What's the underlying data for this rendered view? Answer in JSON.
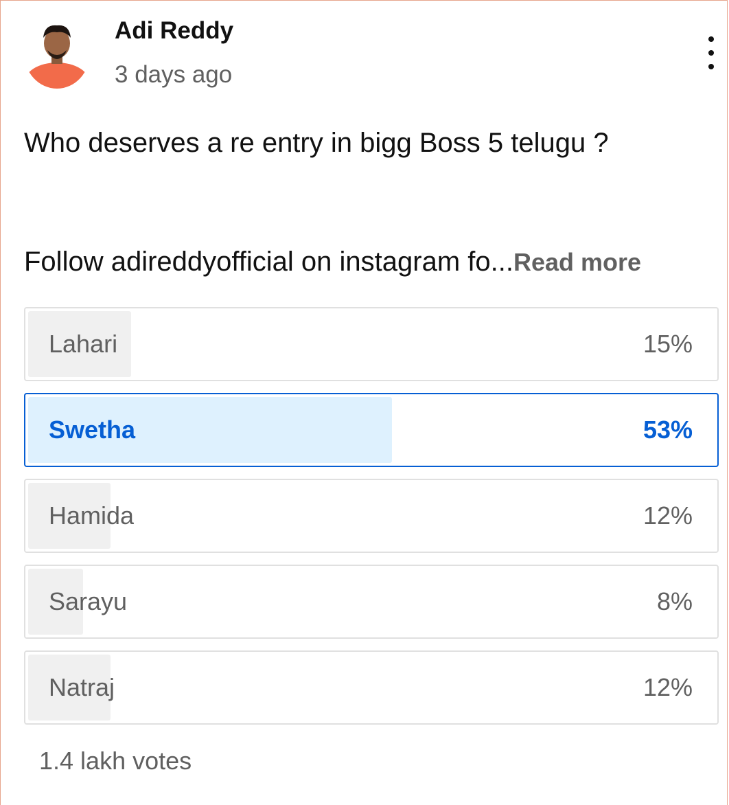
{
  "post": {
    "author": "Adi Reddy",
    "timestamp": "3 days ago",
    "question": "Who deserves a re entry in bigg Boss 5 telugu ?",
    "follow_text": "Follow adireddyofficial on instagram fo...",
    "read_more": "Read more",
    "more_icon": "more-vert-icon"
  },
  "poll": {
    "options": [
      {
        "label": "Lahari",
        "percent": "15%",
        "fill_fraction": 0.15,
        "selected": false
      },
      {
        "label": "Swetha",
        "percent": "53%",
        "fill_fraction": 0.53,
        "selected": true
      },
      {
        "label": "Hamida",
        "percent": "12%",
        "fill_fraction": 0.12,
        "selected": false
      },
      {
        "label": "Sarayu",
        "percent": "8%",
        "fill_fraction": 0.08,
        "selected": false
      },
      {
        "label": "Natraj",
        "percent": "12%",
        "fill_fraction": 0.12,
        "selected": false
      }
    ],
    "votes": "1.4 lakh votes"
  },
  "colors": {
    "accent": "#065fd4",
    "selected_fill": "#def1fe",
    "option_fill": "#f0f0f0",
    "avatar_shirt": "#f26b4a"
  }
}
